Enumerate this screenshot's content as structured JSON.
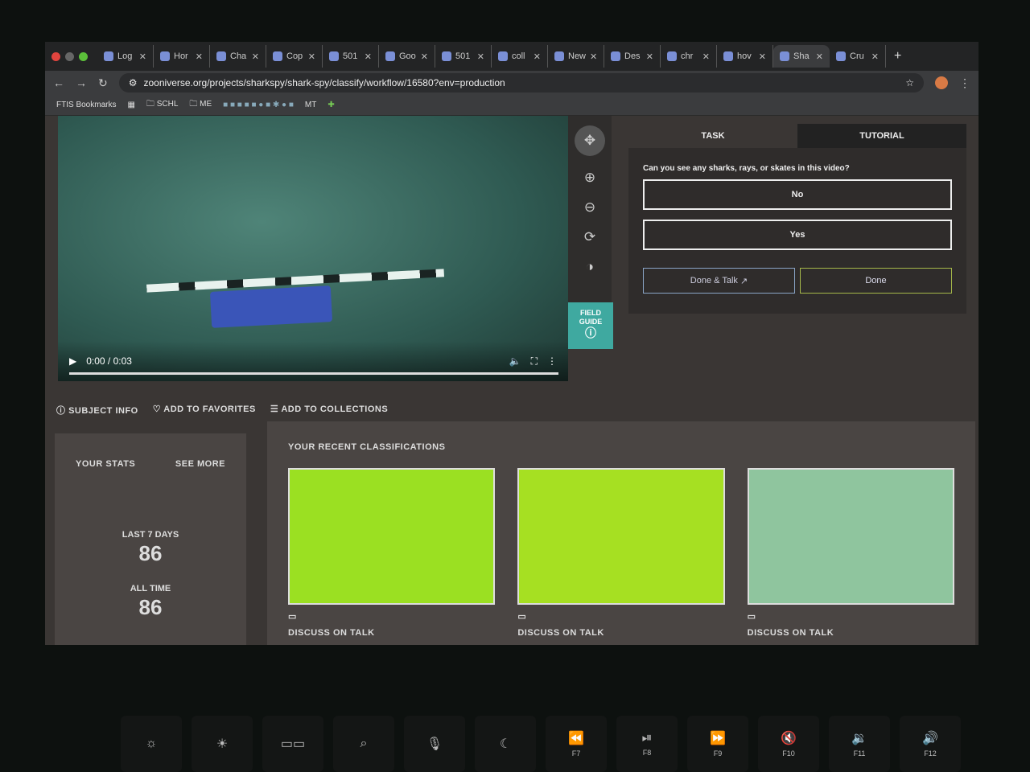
{
  "browser": {
    "tabs": [
      "Log",
      "Hor",
      "Cha",
      "Cop",
      "501",
      "Goo",
      "501",
      "coll",
      "New",
      "Des",
      "chr",
      "hov",
      "Sha",
      "Cru"
    ],
    "active_tab": 12,
    "url": "zooniverse.org/projects/sharkspy/shark-spy/classify/workflow/16580?env=production",
    "bookmarks": [
      "FTIS Bookmarks",
      "SCHL",
      "ME",
      "MT"
    ]
  },
  "video": {
    "time": "0:00 / 0:03"
  },
  "tools": {
    "field_guide": "FIELD GUIDE"
  },
  "task": {
    "tab_task": "TASK",
    "tab_tutorial": "TUTORIAL",
    "question": "Can you see any sharks, rays, or skates in this video?",
    "answers": [
      "No",
      "Yes"
    ],
    "done_talk": "Done & Talk",
    "done": "Done"
  },
  "meta": {
    "subject_info": "SUBJECT INFO",
    "favorites": "ADD TO FAVORITES",
    "collections": "ADD TO COLLECTIONS"
  },
  "stats": {
    "title": "YOUR STATS",
    "see_more": "SEE MORE",
    "last7_label": "LAST 7 DAYS",
    "last7": "86",
    "all_label": "ALL TIME",
    "all": "86"
  },
  "recent": {
    "title": "YOUR RECENT CLASSIFICATIONS",
    "discuss": "DISCUSS ON TALK"
  },
  "keyboard": [
    "F7",
    "F8",
    "F9",
    "F10",
    "F11",
    "F12"
  ]
}
